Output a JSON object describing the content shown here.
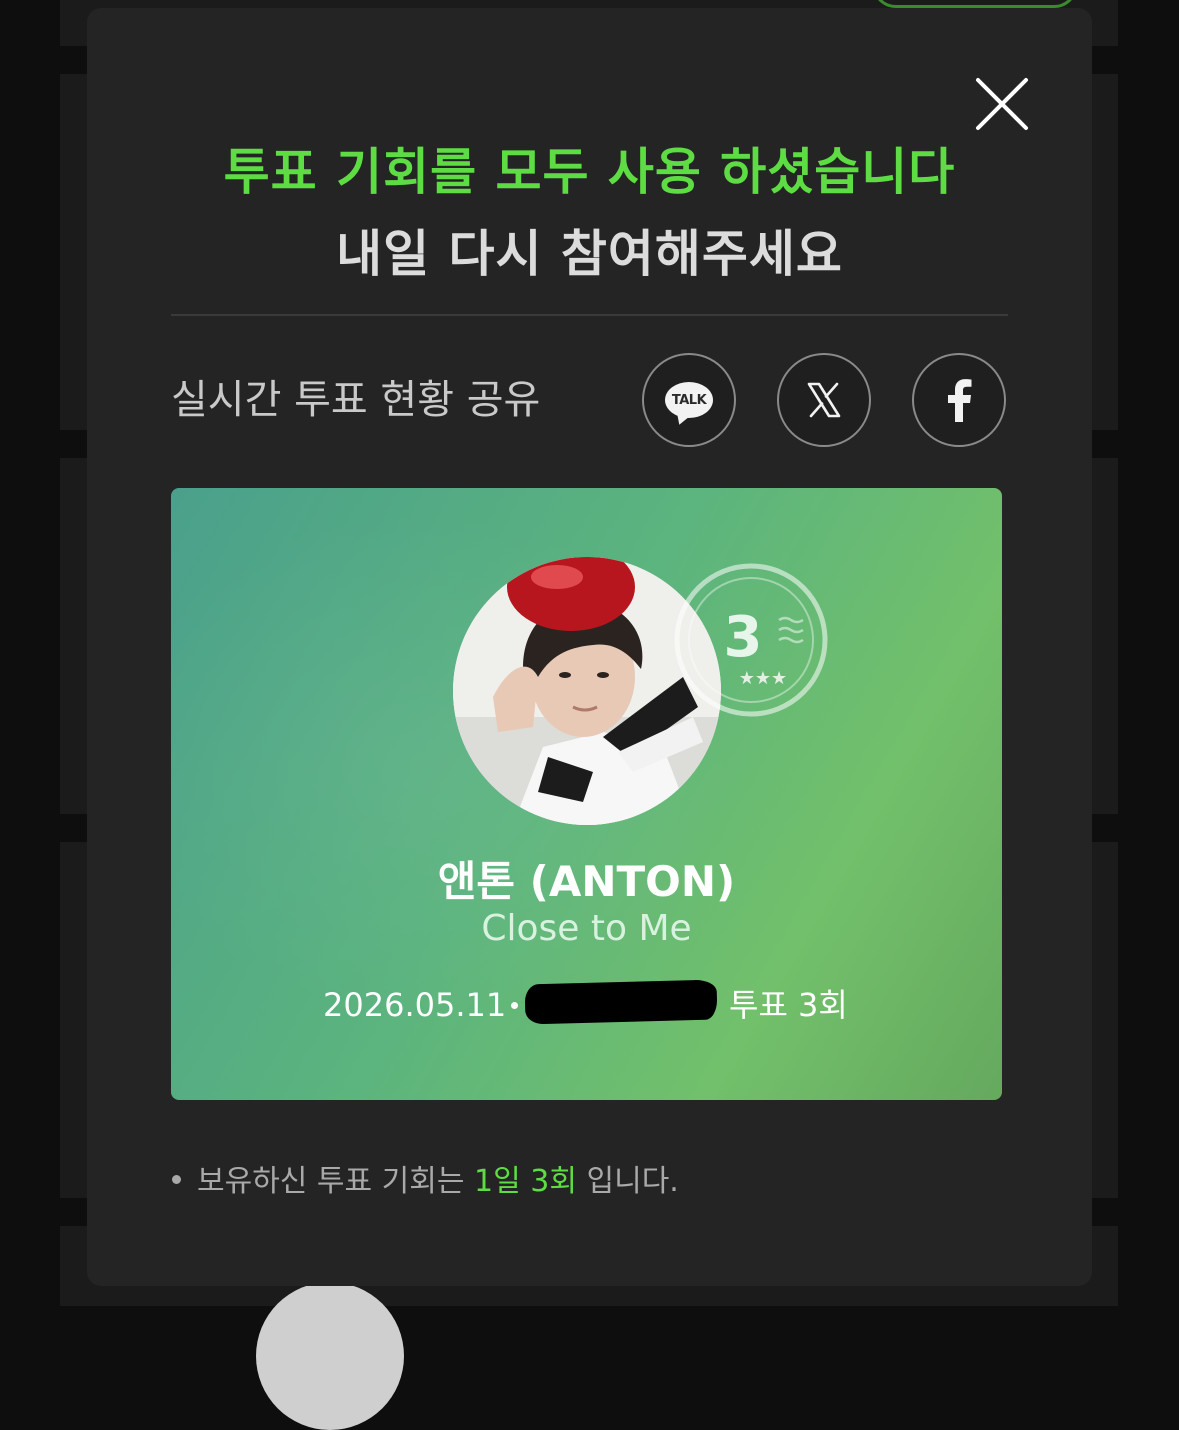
{
  "modal": {
    "title_line1": "투표 기회를 모두 사용 하셨습니다",
    "title_line2": "내일 다시 참여해주세요",
    "share_label": "실시간 투표 현황 공유",
    "share_buttons": [
      {
        "name": "kakaotalk",
        "label": "TALK",
        "icon": "kakaotalk-icon"
      },
      {
        "name": "x",
        "icon": "x-logo-icon"
      },
      {
        "name": "facebook",
        "icon": "facebook-icon"
      }
    ],
    "close_icon": "close-icon"
  },
  "card": {
    "stamp_number": "3",
    "stamp_stars": "★★★",
    "artist_name": "앤톤 (ANTON)",
    "song_title": "Close to Me",
    "date": "2026.05.11",
    "vote_count_visible": "투표 3회"
  },
  "note": {
    "prefix": "보유하신 투표 기회는",
    "highlight": "1일 3회",
    "suffix": "입니다."
  },
  "colors": {
    "accent_green": "#5ddd43",
    "modal_bg": "#242424",
    "card_gradient_start": "#4aa08b",
    "card_gradient_end": "#72c06b"
  }
}
